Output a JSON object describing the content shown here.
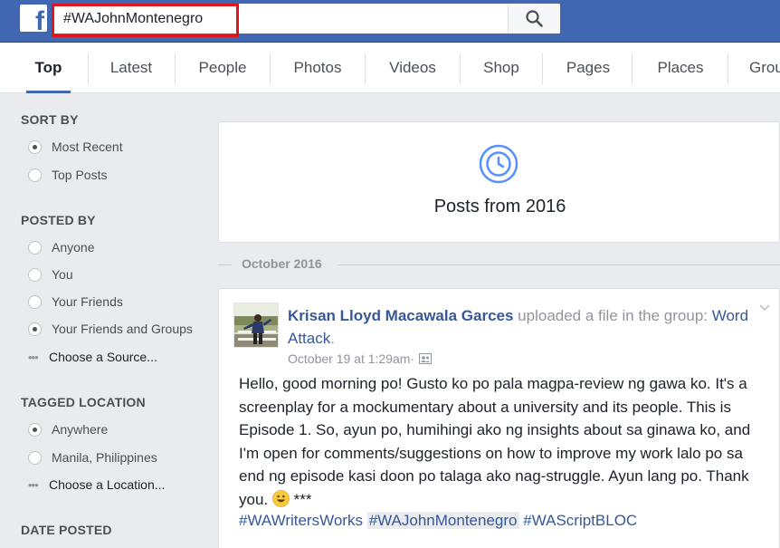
{
  "header": {
    "logo_letter": "f",
    "search_value": "#WAJohnMontenegro",
    "search_icon": "search-icon",
    "brand_color": "#4267b2",
    "highlight_color": "#e0151b"
  },
  "tabs": [
    {
      "label": "Top",
      "active": true
    },
    {
      "label": "Latest"
    },
    {
      "label": "People"
    },
    {
      "label": "Photos"
    },
    {
      "label": "Videos"
    },
    {
      "label": "Shop"
    },
    {
      "label": "Pages"
    },
    {
      "label": "Places"
    },
    {
      "label": "Grou"
    }
  ],
  "filters": {
    "sort_by": {
      "heading": "SORT BY",
      "options": [
        {
          "label": "Most Recent",
          "checked": true
        },
        {
          "label": "Top Posts",
          "checked": false
        }
      ]
    },
    "posted_by": {
      "heading": "POSTED BY",
      "options": [
        {
          "label": "Anyone",
          "checked": false
        },
        {
          "label": "You",
          "checked": false
        },
        {
          "label": "Your Friends",
          "checked": false
        },
        {
          "label": "Your Friends and Groups",
          "checked": true
        }
      ],
      "more": "Choose a Source..."
    },
    "tagged_location": {
      "heading": "TAGGED LOCATION",
      "options": [
        {
          "label": "Anywhere",
          "checked": true
        },
        {
          "label": "Manila, Philippines",
          "checked": false
        }
      ],
      "more": "Choose a Location..."
    },
    "date_posted": {
      "heading": "DATE POSTED"
    }
  },
  "posts_header": {
    "icon": "clock-icon",
    "title": "Posts from 2016"
  },
  "month_divider": "October 2016",
  "post": {
    "author": "Krisan Lloyd Macawala Garces",
    "action": " uploaded a file in the group: ",
    "group": "Word Attack",
    "group_suffix": ".",
    "timestamp": "October 19 at 1:29am",
    "meta_sep": " · ",
    "audience_icon": "group-audience-icon",
    "body": "Hello, good morning po! Gusto ko po pala magpa-review ng gawa ko. It's a screenplay for a mockumentary about a university and its people. This is Episode 1. So, ayun po, humihingi ako ng insights about sa ginawa ko, and I'm open for comments/suggestions on how to improve my work lalo po sa end ng episode kasi doon po talaga ako nag-struggle. Ayun lang po. Thank you.",
    "body_suffix": " ***",
    "emoji": "smiley-emoji-icon",
    "hashtags": [
      "#WAWritersWorks",
      "#WAJohnMontenegro",
      "#WAScriptBLOC"
    ]
  }
}
